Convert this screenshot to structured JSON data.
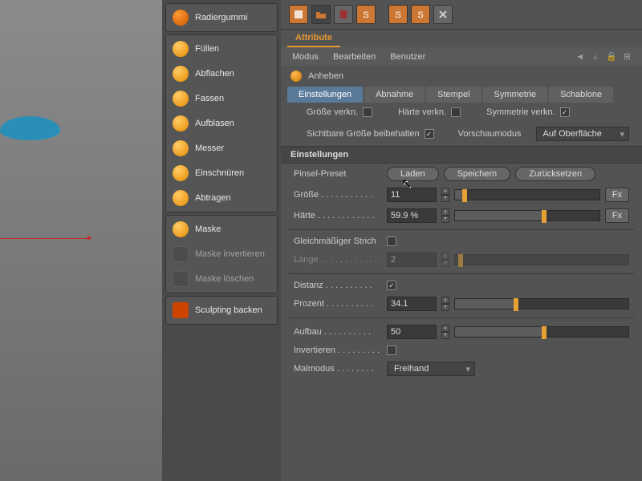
{
  "tools": {
    "group1": [
      {
        "label": "Radiergummi",
        "icon": "orange"
      }
    ],
    "group2": [
      {
        "label": "Füllen",
        "icon": "std"
      },
      {
        "label": "Abflachen",
        "icon": "std"
      },
      {
        "label": "Fassen",
        "icon": "std"
      },
      {
        "label": "Aufblasen",
        "icon": "std"
      },
      {
        "label": "Messer",
        "icon": "std"
      },
      {
        "label": "Einschnüren",
        "icon": "std"
      },
      {
        "label": "Abtragen",
        "icon": "std"
      }
    ],
    "group3": [
      {
        "label": "Maske",
        "icon": "std"
      },
      {
        "label": "Maske invertieren",
        "icon": "square",
        "disabled": true
      },
      {
        "label": "Maske löschen",
        "icon": "square",
        "disabled": true
      }
    ],
    "group4": [
      {
        "label": "Sculpting backen",
        "icon": "bake"
      }
    ]
  },
  "tab": "Attribute",
  "menus": [
    "Modus",
    "Bearbeiten",
    "Benutzer"
  ],
  "mode": "Anheben",
  "ptabs": [
    "Einstellungen",
    "Abnahme",
    "Stempel",
    "Symmetrie",
    "Schablone"
  ],
  "activePtab": 0,
  "checks1": {
    "size_link": "Größe verkn.",
    "hard_link": "Härte verkn.",
    "sym_link": "Symmetrie verkn."
  },
  "checks2": {
    "visible_size": "Sichtbare Größe beibehalten",
    "preview": "Vorschaumodus",
    "preview_val": "Auf Oberfläche"
  },
  "section": "Einstellungen",
  "preset": {
    "label": "Pinsel-Preset",
    "load": "Laden",
    "save": "Speichern",
    "reset": "Zurücksetzen"
  },
  "params": {
    "size_label": "Größe",
    "size_val": "11",
    "hard_label": "Härte",
    "hard_val": "59.9 %",
    "fx": "Fx",
    "even_label": "Gleichmäßiger Strich",
    "length_label": "Länge",
    "length_val": "2",
    "dist_label": "Distanz",
    "percent_label": "Prozent",
    "percent_val": "34.1",
    "buildup_label": "Aufbau",
    "buildup_val": "50",
    "invert_label": "Invertieren",
    "paintmode_label": "Malmodus",
    "paintmode_val": "Freihand"
  }
}
